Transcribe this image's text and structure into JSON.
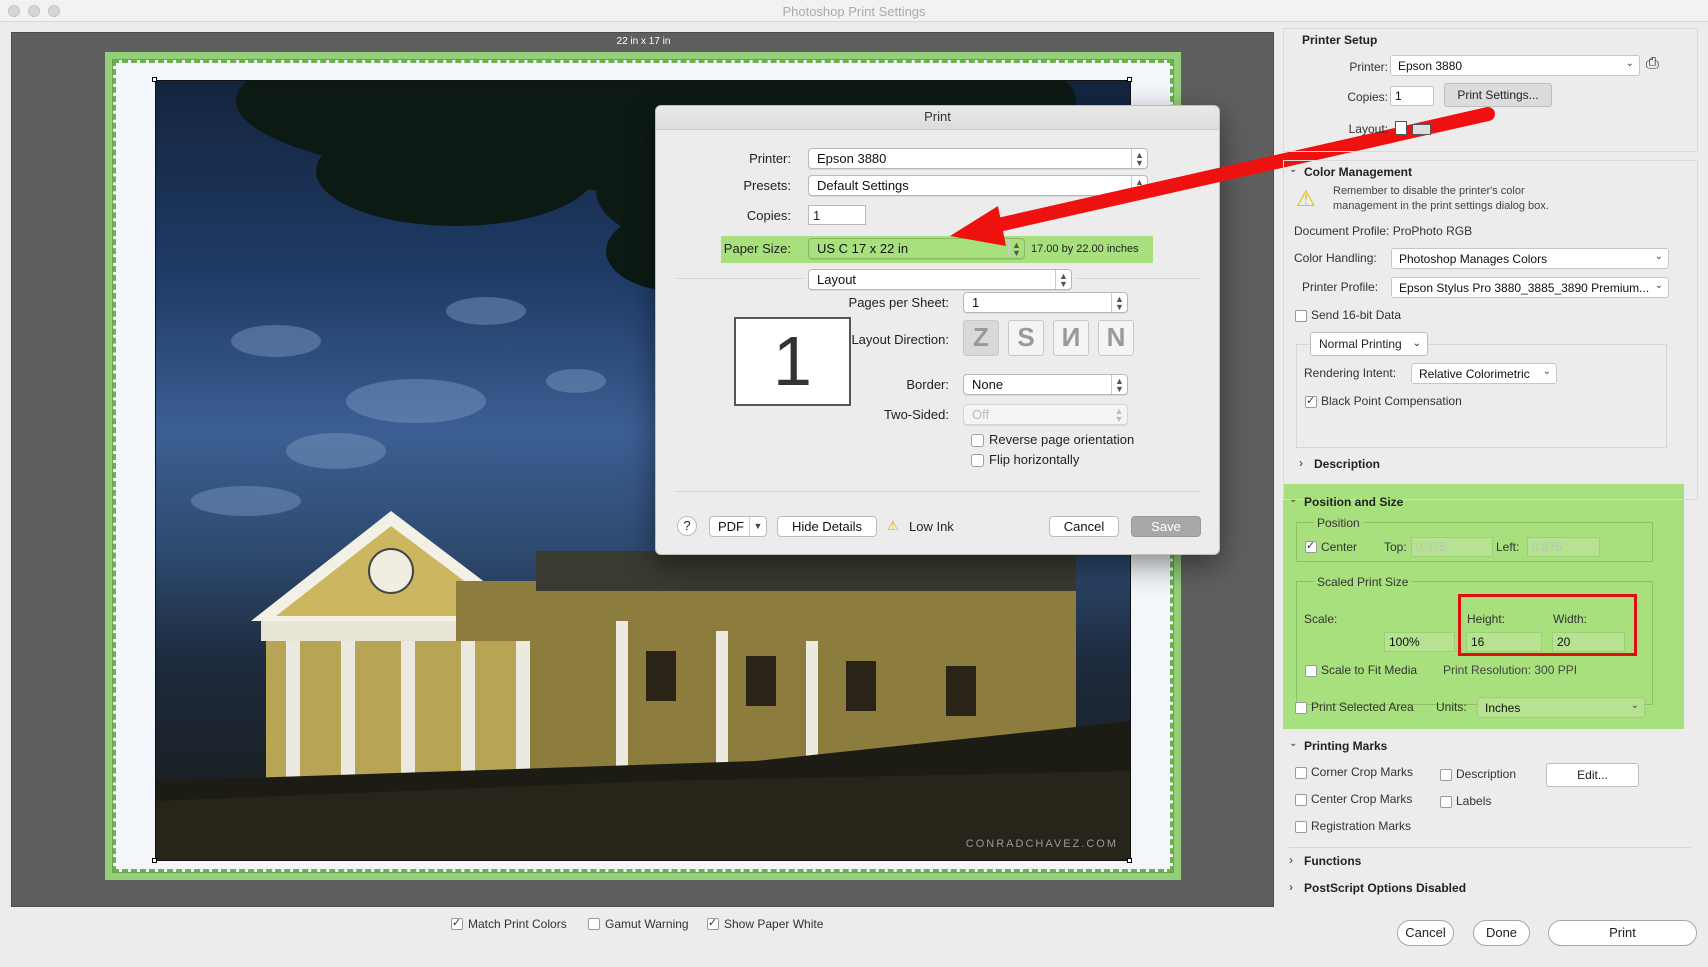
{
  "window": {
    "title": "Photoshop Print Settings"
  },
  "preview": {
    "paper_label": "22 in x 17 in",
    "watermark": "CONRADCHAVEZ.COM"
  },
  "print_dialog": {
    "title": "Print",
    "printer_label": "Printer:",
    "printer_value": "Epson 3880",
    "presets_label": "Presets:",
    "presets_value": "Default Settings",
    "copies_label": "Copies:",
    "copies_value": "1",
    "paper_size_label": "Paper Size:",
    "paper_size_value": "US C 17 x 22 in",
    "paper_size_dimensions": "17.00 by 22.00 inches",
    "panel_select": "Layout",
    "page_preview_number": "1",
    "pages_per_sheet_label": "Pages per Sheet:",
    "pages_per_sheet_value": "1",
    "layout_direction_label": "Layout Direction:",
    "layout_direction_glyphs": [
      "Z",
      "S",
      "N",
      "N"
    ],
    "border_label": "Border:",
    "border_value": "None",
    "two_sided_label": "Two-Sided:",
    "two_sided_value": "Off",
    "reverse_label": "Reverse page orientation",
    "flip_label": "Flip horizontally",
    "help_label": "?",
    "pdf_label": "PDF",
    "hide_details_label": "Hide Details",
    "low_ink_label": "Low Ink",
    "cancel_label": "Cancel",
    "save_label": "Save"
  },
  "printer_setup": {
    "heading": "Printer Setup",
    "printer_label": "Printer:",
    "printer_value": "Epson 3880",
    "copies_label": "Copies:",
    "copies_value": "1",
    "print_settings_label": "Print Settings...",
    "layout_label": "Layout:"
  },
  "color_management": {
    "heading": "Color Management",
    "warning_line1": "Remember to disable the printer's color",
    "warning_line2": "management in the print settings dialog box.",
    "document_profile": "Document Profile: ProPhoto RGB",
    "color_handling_label": "Color Handling:",
    "color_handling_value": "Photoshop Manages Colors",
    "printer_profile_label": "Printer Profile:",
    "printer_profile_value": "Epson Stylus Pro 3880_3885_3890 Premium...",
    "send16_label": "Send 16-bit Data",
    "normal_printing_value": "Normal Printing",
    "rendering_intent_label": "Rendering Intent:",
    "rendering_intent_value": "Relative Colorimetric",
    "bpc_label": "Black Point Compensation"
  },
  "description": {
    "heading": "Description"
  },
  "position_size": {
    "heading": "Position and Size",
    "position_label": "Position",
    "center_label": "Center",
    "top_label": "Top:",
    "top_value": "0.375",
    "left_label": "Left:",
    "left_value": "0.875",
    "scaled_label": "Scaled Print Size",
    "scale_label": "Scale:",
    "scale_value": "100%",
    "height_label": "Height:",
    "height_value": "16",
    "width_label": "Width:",
    "width_value": "20",
    "fit_media_label": "Scale to Fit Media",
    "resolution": "Print Resolution: 300 PPI",
    "selected_area_label": "Print Selected Area",
    "units_label": "Units:",
    "units_value": "Inches"
  },
  "printing_marks": {
    "heading": "Printing Marks",
    "corner_crop": "Corner Crop Marks",
    "description": "Description",
    "edit_label": "Edit...",
    "center_crop": "Center Crop Marks",
    "labels": "Labels",
    "registration": "Registration Marks"
  },
  "functions": {
    "heading": "Functions"
  },
  "postscript": {
    "heading": "PostScript Options Disabled"
  },
  "footer": {
    "match_colors": "Match Print Colors",
    "gamut_warning": "Gamut Warning",
    "show_paper_white": "Show Paper White",
    "cancel_label": "Cancel",
    "done_label": "Done",
    "print_label": "Print"
  }
}
